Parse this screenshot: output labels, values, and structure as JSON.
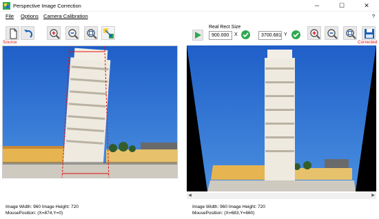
{
  "window": {
    "title": "Perspective Image Correction",
    "minimize_glyph": "─",
    "maximize_glyph": "☐",
    "close_glyph": "✕"
  },
  "menu": {
    "file": "File",
    "options": "Options",
    "camera_calibration": "Camera Calibration",
    "help": "?"
  },
  "toolbar": {
    "source_label": "Source",
    "corrected_label": "Corrected",
    "real_rect_label": "Real Rect Size",
    "width_value": "900.000",
    "x_label": "X",
    "height_value": "3700.681",
    "y_label": "Y"
  },
  "source_info": {
    "dimensions": "Image Width: 960 Image Height: 720",
    "mouse_position": "MousePosition: (X=874,Y=0)"
  },
  "corrected_info": {
    "dimensions": "Image Width: 960 Image Height: 720",
    "mouse_position": "MousePosition: (X=683,Y=660)"
  },
  "icons": {
    "new": "new-document-icon",
    "undo": "undo-icon",
    "zoom_in": "zoom-in-icon",
    "zoom_out": "zoom-out-icon",
    "zoom_fit": "zoom-fit-icon",
    "select_points": "select-points-icon",
    "run": "play-icon",
    "confirm": "check-icon",
    "save": "save-icon"
  },
  "colors": {
    "accent_red": "#e01010",
    "sky": "#2a6fd0",
    "go_green": "#2fa84f"
  }
}
